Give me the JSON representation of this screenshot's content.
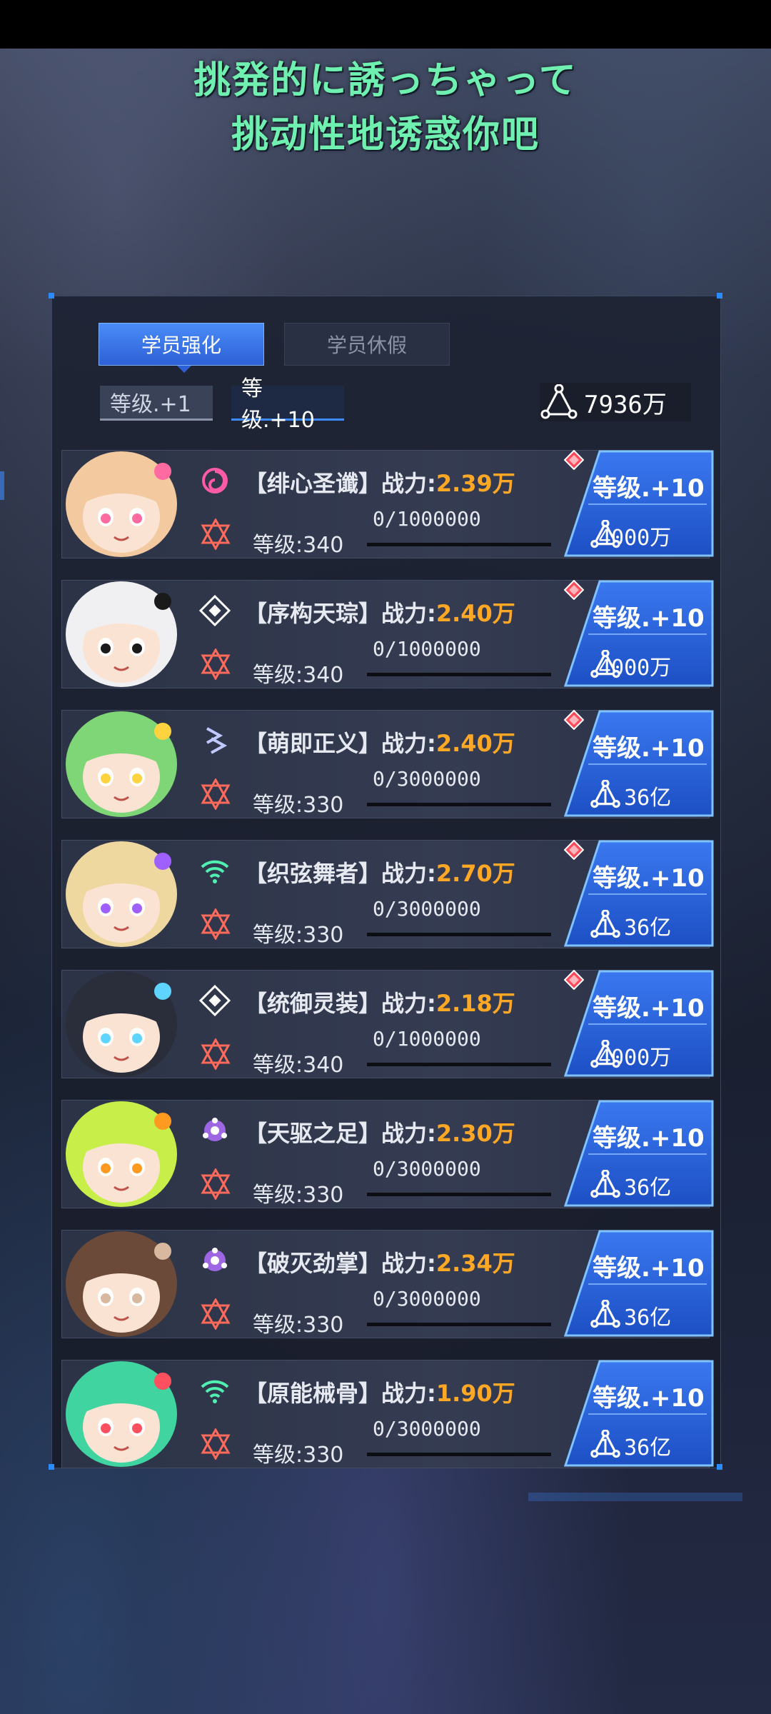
{
  "subtitles": {
    "line1": "挑発的に誘っちゃって",
    "line2": "挑动性地诱惑你吧"
  },
  "tabs": {
    "active_label": "学员强化",
    "inactive_label": "学员休假"
  },
  "level_options": {
    "plus1": "等级.+1",
    "plus10": "等级.+10",
    "selected": "等级.+10"
  },
  "resource": {
    "icon": "triangle-nodes-icon",
    "amount": "7936万"
  },
  "students": [
    {
      "name": "【绯心圣谶】",
      "power_label": "战力:",
      "power": "2.39万",
      "progress": "0/1000000",
      "progress_fraction": 0,
      "level": "等级:340",
      "upgrade_label": "等级.+10",
      "cost": "4000万",
      "has_alert": true,
      "element_icon": "swirl-icon",
      "element_color": "#ff5aa8",
      "avatar_hair": "#f3c9a0",
      "avatar_accent": "#ff6aa0"
    },
    {
      "name": "【序构天琮】",
      "power_label": "战力:",
      "power": "2.40万",
      "progress": "0/1000000",
      "progress_fraction": 0,
      "level": "等级:340",
      "upgrade_label": "等级.+10",
      "cost": "4000万",
      "has_alert": true,
      "element_icon": "diamond-core-icon",
      "element_color": "#ffffff",
      "avatar_hair": "#f0f0f2",
      "avatar_accent": "#1a1a1a"
    },
    {
      "name": "【萌即正义】",
      "power_label": "战力:",
      "power": "2.40万",
      "progress": "0/3000000",
      "progress_fraction": 0,
      "level": "等级:330",
      "upgrade_label": "等级.+10",
      "cost": "1.36亿",
      "has_alert": true,
      "element_icon": "chevron-stack-icon",
      "element_color": "#c0c8ff",
      "avatar_hair": "#7fd676",
      "avatar_accent": "#ffd23f"
    },
    {
      "name": "【织弦舞者】",
      "power_label": "战力:",
      "power": "2.70万",
      "progress": "0/3000000",
      "progress_fraction": 0,
      "level": "等级:330",
      "upgrade_label": "等级.+10",
      "cost": "1.36亿",
      "has_alert": true,
      "element_icon": "signal-icon",
      "element_color": "#4ff0b0",
      "avatar_hair": "#efd7a0",
      "avatar_accent": "#a060ff"
    },
    {
      "name": "【统御灵装】",
      "power_label": "战力:",
      "power": "2.18万",
      "progress": "0/1000000",
      "progress_fraction": 0,
      "level": "等级:340",
      "upgrade_label": "等级.+10",
      "cost": "4000万",
      "has_alert": true,
      "element_icon": "diamond-core-icon",
      "element_color": "#ffffff",
      "avatar_hair": "#2a2d3a",
      "avatar_accent": "#5fd4ff"
    },
    {
      "name": "【天驱之足】",
      "power_label": "战力:",
      "power": "2.30万",
      "progress": "0/3000000",
      "progress_fraction": 0,
      "level": "等级:330",
      "upgrade_label": "等级.+10",
      "cost": "1.36亿",
      "has_alert": false,
      "element_icon": "orbit-flower-icon",
      "element_color": "#b070ff",
      "avatar_hair": "#c8ee4a",
      "avatar_accent": "#ff9a20"
    },
    {
      "name": "【破灭劲掌】",
      "power_label": "战力:",
      "power": "2.34万",
      "progress": "0/3000000",
      "progress_fraction": 0,
      "level": "等级:330",
      "upgrade_label": "等级.+10",
      "cost": "1.36亿",
      "has_alert": false,
      "element_icon": "orbit-flower-icon",
      "element_color": "#b070ff",
      "avatar_hair": "#6b4a3a",
      "avatar_accent": "#d8b9a0"
    },
    {
      "name": "【原能械骨】",
      "power_label": "战力:",
      "power": "1.90万",
      "progress": "0/3000000",
      "progress_fraction": 0,
      "level": "等级:330",
      "upgrade_label": "等级.+10",
      "cost": "1.36亿",
      "has_alert": false,
      "element_icon": "signal-icon",
      "element_color": "#4ff0b0",
      "avatar_hair": "#3fd4a0",
      "avatar_accent": "#ff5060"
    }
  ],
  "colors": {
    "accent_blue": "#2d60d6",
    "power_orange": "#ffa826",
    "subtitle_green": "#6ff0b0",
    "alert_red": "#ff4a5a"
  }
}
